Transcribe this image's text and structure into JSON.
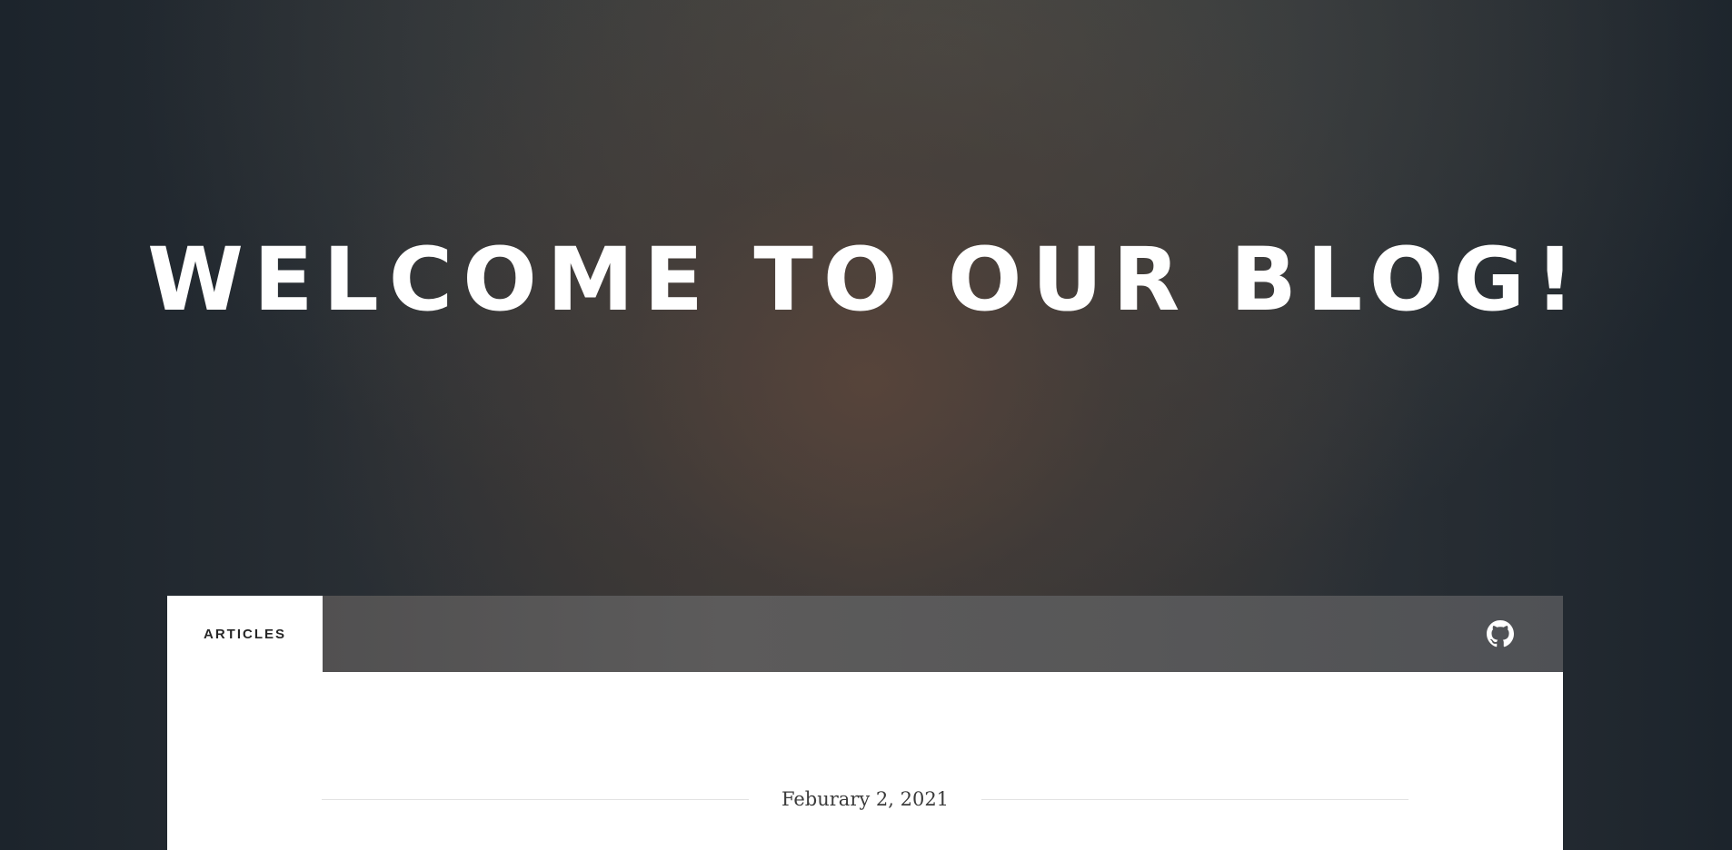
{
  "hero": {
    "title": "WELCOME TO OUR BLOG!"
  },
  "nav": {
    "tabs": [
      {
        "label": "ARTICLES",
        "active": true
      }
    ],
    "social": [
      {
        "icon": "github-icon"
      }
    ]
  },
  "content": {
    "post_date": "Feburary 2, 2021"
  },
  "colors": {
    "nav_bar": "#575758",
    "tab_active_bg": "#ffffff",
    "text_dark": "#262626",
    "divider": "#e2e2e2"
  }
}
